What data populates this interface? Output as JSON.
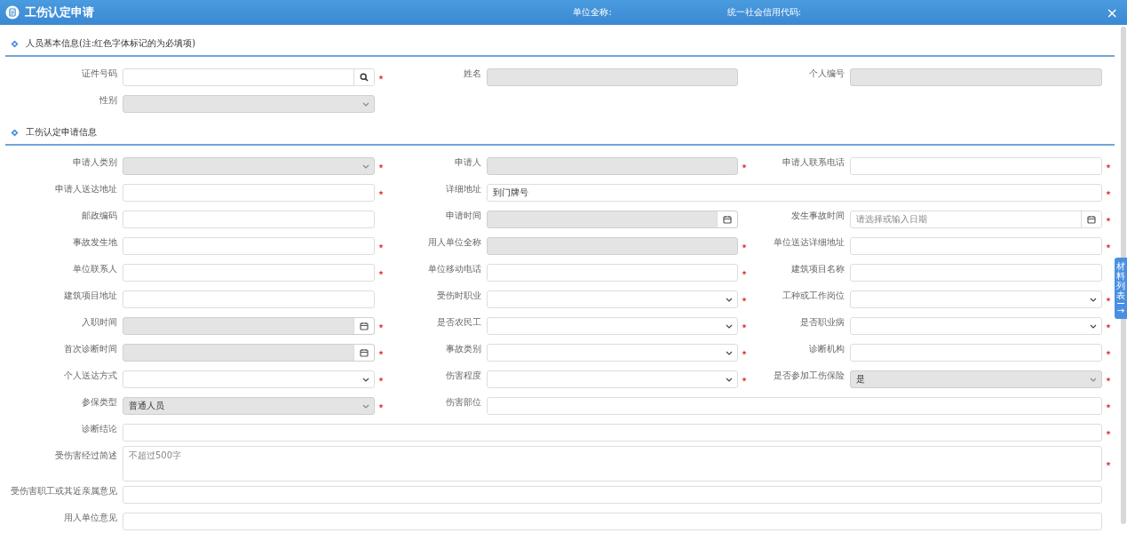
{
  "header": {
    "title": "工伤认定申请",
    "fields": [
      {
        "label": "单位全称:"
      },
      {
        "label": "统一社会信用代码:"
      }
    ],
    "close": "×"
  },
  "sections": [
    {
      "title": "人员基本信息(注:红色字体标记的为必填项)",
      "rows": [
        [
          {
            "label": "证件号码",
            "kind": "search",
            "disabled": false,
            "required": true
          },
          {
            "label": "姓名",
            "kind": "input",
            "disabled": true,
            "required": false
          },
          {
            "label": "个人编号",
            "kind": "input",
            "disabled": true,
            "required": false
          }
        ],
        [
          {
            "label": "性别",
            "kind": "select",
            "disabled": true,
            "required": false
          }
        ]
      ]
    },
    {
      "title": "工伤认定申请信息",
      "rows": [
        [
          {
            "label": "申请人类别",
            "kind": "select",
            "disabled": true,
            "required": true
          },
          {
            "label": "申请人",
            "kind": "input",
            "disabled": true,
            "required": true
          },
          {
            "label": "申请人联系电话",
            "kind": "input",
            "disabled": false,
            "required": true
          }
        ],
        [
          {
            "label": "申请人送达地址",
            "kind": "input",
            "disabled": false,
            "required": true
          },
          {
            "label": "详细地址",
            "kind": "input",
            "disabled": false,
            "required": true,
            "wide": true,
            "value": "到门牌号"
          }
        ],
        [
          {
            "label": "邮政编码",
            "kind": "input",
            "disabled": false,
            "required": false
          },
          {
            "label": "申请时间",
            "kind": "date",
            "disabled": true,
            "required": false
          },
          {
            "label": "发生事故时间",
            "kind": "date",
            "disabled": false,
            "required": true,
            "placeholder": "请选择或输入日期"
          }
        ],
        [
          {
            "label": "事故发生地",
            "kind": "input",
            "disabled": false,
            "required": true
          },
          {
            "label": "用人单位全称",
            "kind": "input",
            "disabled": true,
            "required": true
          },
          {
            "label": "单位送达详细地址",
            "kind": "input",
            "disabled": false,
            "required": true
          }
        ],
        [
          {
            "label": "单位联系人",
            "kind": "input",
            "disabled": false,
            "required": true
          },
          {
            "label": "单位移动电话",
            "kind": "input",
            "disabled": false,
            "required": true
          },
          {
            "label": "建筑项目名称",
            "kind": "input",
            "disabled": false,
            "required": false
          }
        ],
        [
          {
            "label": "建筑项目地址",
            "kind": "input",
            "disabled": false,
            "required": false
          },
          {
            "label": "受伤时职业",
            "kind": "select",
            "disabled": false,
            "required": true
          },
          {
            "label": "工种或工作岗位",
            "kind": "select",
            "disabled": false,
            "required": true
          }
        ],
        [
          {
            "label": "入职时间",
            "kind": "date",
            "disabled": true,
            "required": true
          },
          {
            "label": "是否农民工",
            "kind": "select",
            "disabled": false,
            "required": true
          },
          {
            "label": "是否职业病",
            "kind": "select",
            "disabled": false,
            "required": true
          }
        ],
        [
          {
            "label": "首次诊断时间",
            "kind": "date",
            "disabled": true,
            "required": true
          },
          {
            "label": "事故类别",
            "kind": "select",
            "disabled": false,
            "required": true
          },
          {
            "label": "诊断机构",
            "kind": "input",
            "disabled": false,
            "required": true
          }
        ],
        [
          {
            "label": "个人送达方式",
            "kind": "select",
            "disabled": false,
            "required": true
          },
          {
            "label": "伤害程度",
            "kind": "select",
            "disabled": false,
            "required": true
          },
          {
            "label": "是否参加工伤保险",
            "kind": "select",
            "disabled": true,
            "required": true,
            "value": "是"
          }
        ],
        [
          {
            "label": "参保类型",
            "kind": "select",
            "disabled": true,
            "required": true,
            "value": "普通人员"
          },
          {
            "label": "伤害部位",
            "kind": "input",
            "disabled": false,
            "required": true,
            "wide": true
          }
        ],
        [
          {
            "label": "诊断结论",
            "kind": "input",
            "disabled": false,
            "required": true,
            "wide": true
          }
        ],
        [
          {
            "label": "受伤害经过简述",
            "kind": "textarea",
            "disabled": false,
            "required": true,
            "wide": true,
            "placeholder": "不超过500字"
          }
        ],
        [
          {
            "label": "受伤害职工或其近亲属意见",
            "kind": "input",
            "disabled": false,
            "required": false,
            "wide": true
          }
        ],
        [
          {
            "label": "用人单位意见",
            "kind": "input",
            "disabled": false,
            "required": false,
            "wide": true
          }
        ]
      ]
    }
  ],
  "side_tab": {
    "label": "材料列表",
    "arrow": "→"
  }
}
